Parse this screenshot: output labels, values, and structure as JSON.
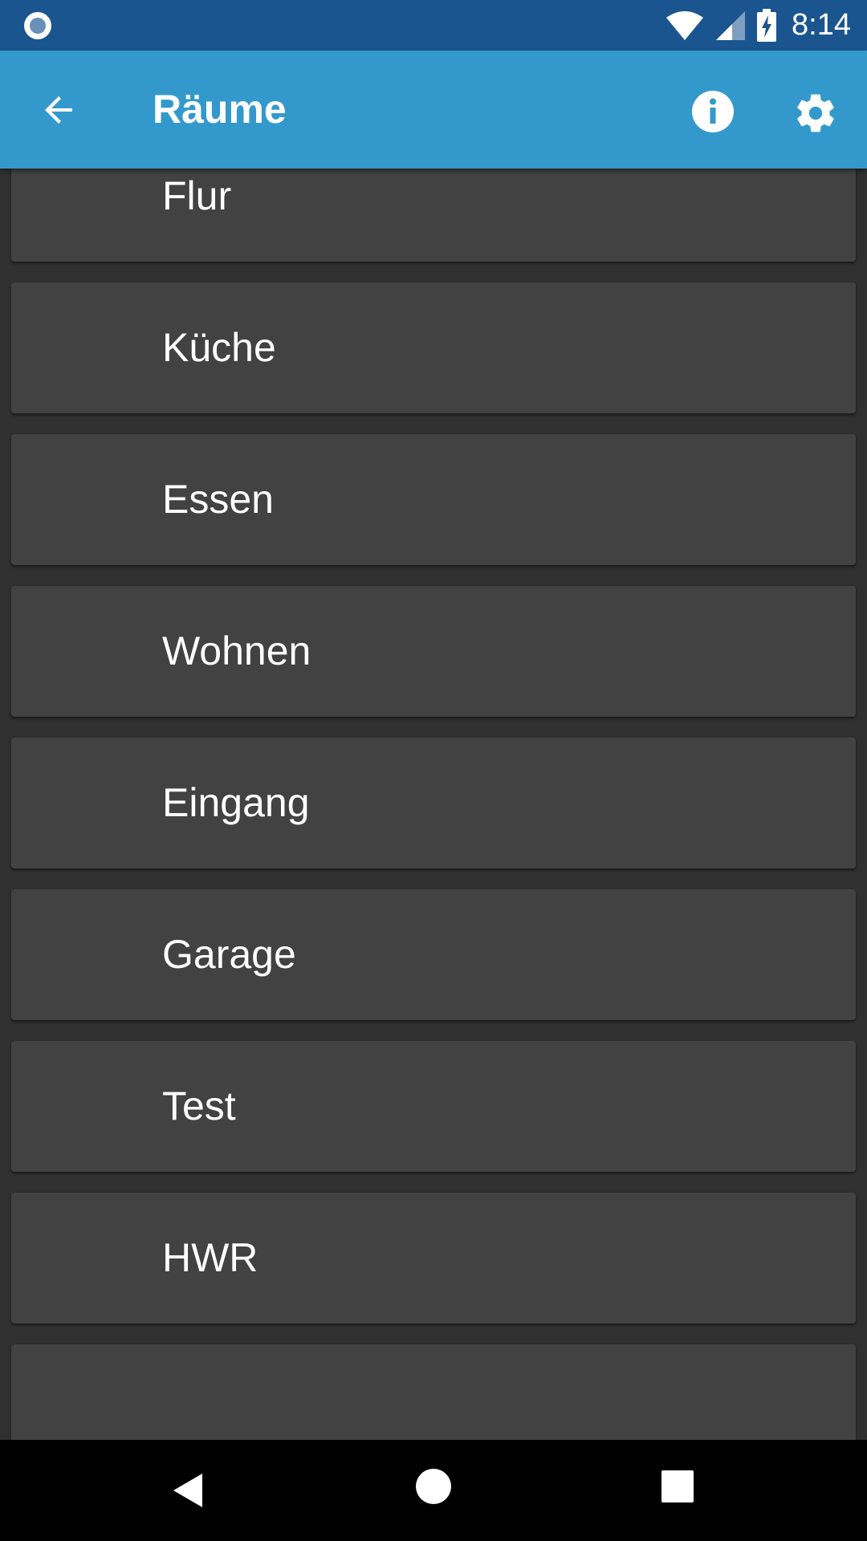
{
  "status_bar": {
    "time": "8:14",
    "icons": [
      "notification-circle-icon",
      "wifi-icon",
      "cell-signal-icon",
      "battery-charging-icon"
    ]
  },
  "app_bar": {
    "title": "Räume",
    "back_icon": "arrow-back-icon",
    "info_icon": "info-icon",
    "settings_icon": "gear-icon",
    "background_color": "#3399cc"
  },
  "rooms": [
    {
      "label": "Flur"
    },
    {
      "label": "Küche"
    },
    {
      "label": "Essen"
    },
    {
      "label": "Wohnen"
    },
    {
      "label": "Eingang"
    },
    {
      "label": "Garage"
    },
    {
      "label": "Test"
    },
    {
      "label": "HWR"
    },
    {
      "label": ""
    }
  ],
  "nav_bar": {
    "back_icon": "triangle-back-icon",
    "home_icon": "circle-home-icon",
    "recents_icon": "square-recents-icon"
  }
}
